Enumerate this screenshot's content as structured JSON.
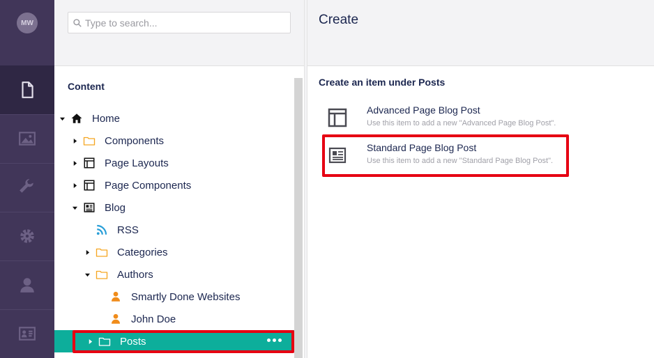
{
  "user": {
    "initials": "MW"
  },
  "rail": {
    "items": [
      {
        "icon": "document-icon",
        "active": true
      },
      {
        "icon": "image-icon",
        "active": false
      },
      {
        "icon": "wrench-icon",
        "active": false
      },
      {
        "icon": "gear-icon",
        "active": false
      },
      {
        "icon": "user-icon",
        "active": false
      },
      {
        "icon": "id-card-icon",
        "active": false
      }
    ]
  },
  "search": {
    "placeholder": "Type to search..."
  },
  "tree": {
    "title": "Content",
    "nodes": [
      {
        "label": "Home",
        "icon": "home-icon",
        "caret": "down"
      },
      {
        "label": "Components",
        "icon": "folder-icon",
        "caret": "right"
      },
      {
        "label": "Page Layouts",
        "icon": "layout-icon",
        "caret": "right"
      },
      {
        "label": "Page Components",
        "icon": "layout-icon",
        "caret": "right"
      },
      {
        "label": "Blog",
        "icon": "blog-icon",
        "caret": "down"
      },
      {
        "label": "RSS",
        "icon": "rss-icon",
        "caret": "none"
      },
      {
        "label": "Categories",
        "icon": "folder-icon",
        "caret": "right"
      },
      {
        "label": "Authors",
        "icon": "folder-icon",
        "caret": "down"
      },
      {
        "label": "Smartly Done Websites",
        "icon": "author-icon",
        "caret": "none"
      },
      {
        "label": "John Doe",
        "icon": "author-icon",
        "caret": "none"
      },
      {
        "label": "Posts",
        "icon": "folder-icon",
        "caret": "right",
        "selected": true
      }
    ]
  },
  "create": {
    "title": "Create",
    "subtitle": "Create an item under Posts",
    "options": [
      {
        "name": "Advanced Page Blog Post",
        "description": "Use this item to add a new \"Advanced Page Blog Post\"."
      },
      {
        "name": "Standard Page Blog Post",
        "description": "Use this item to add a new \"Standard Page Blog Post\"."
      }
    ]
  },
  "colors": {
    "rail": "#413659",
    "selected": "#0dae9b",
    "highlight": "#e60012",
    "folder": "#f5a623",
    "rss": "#2a9fd8",
    "author": "#f08c1a"
  }
}
